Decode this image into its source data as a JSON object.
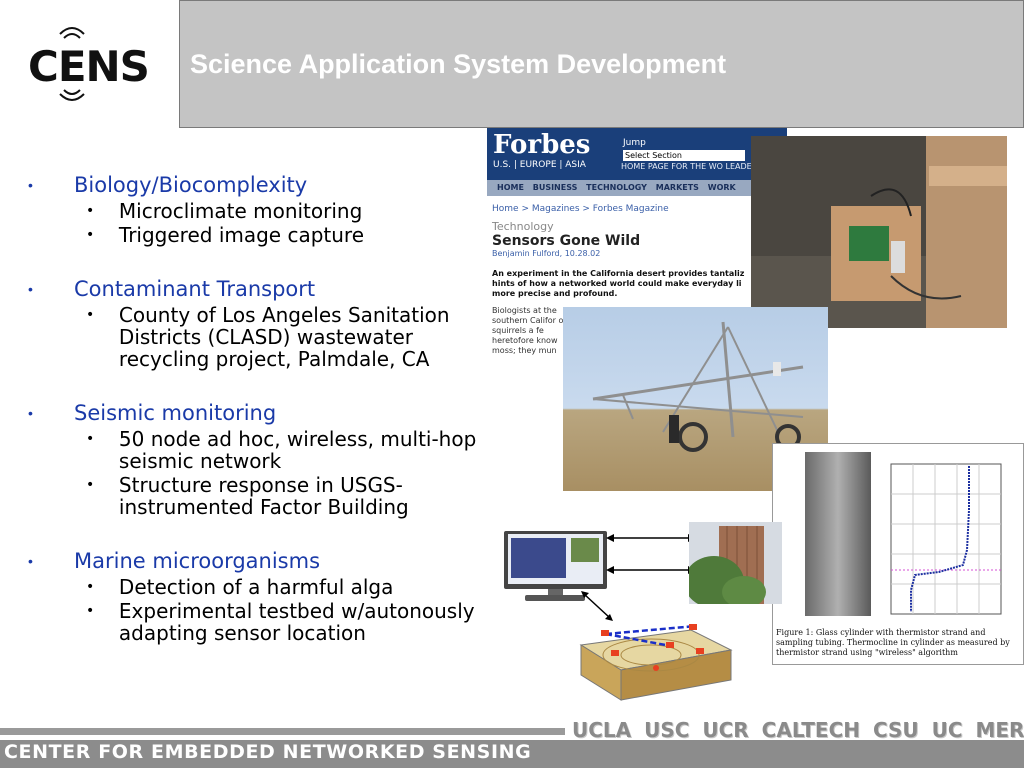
{
  "logo": {
    "text": "CENS"
  },
  "title": "Science Application System Development",
  "bullets": [
    {
      "label": "Biology/Biocomplexity",
      "subs": [
        "Microclimate monitoring",
        "Triggered image capture"
      ]
    },
    {
      "label": "Contaminant Transport",
      "subs": [
        "County of Los Angeles Sanitation Districts (CLASD) wastewater recycling project, Palmdale, CA"
      ]
    },
    {
      "label": "Seismic monitoring",
      "subs": [
        "50 node ad hoc, wireless, multi-hop seismic network",
        "Structure response in USGS-instrumented Factor Building"
      ]
    },
    {
      "label": "Marine microorganisms",
      "subs": [
        "Detection of a  harmful alga",
        "Experimental testbed w/autonously adapting sensor location"
      ]
    }
  ],
  "bullet_glyph": "•",
  "forbes": {
    "logo": "Forbes",
    "regions": "U.S. | EUROPE | ASIA",
    "jump": "Jump",
    "select": "Select Section",
    "home_link": "HOME PAGE FOR THE WO LEADERS",
    "nav": [
      "HOME",
      "BUSINESS",
      "TECHNOLOGY",
      "MARKETS",
      "WORK"
    ],
    "breadcrumb": "Home > Magazines > Forbes Magazine",
    "section": "Technology",
    "headline": "Sensors Gone Wild",
    "author": "Benjamin Fulford, 10.28.02",
    "lede": "An experiment in the California desert provides tantaliz hints of how a networked world could make everyday li more precise and profound.",
    "body": "Biologists at the southern Califor of squirrels a fe heretofore know moss; they mun been in the right"
  },
  "figure": {
    "caption": "Figure 1: Glass cylinder with thermistor strand and sampling tubing. Thermocline in cylinder as measured by thermistor strand using \"wireless\" algorithm"
  },
  "footer": {
    "org": "CENTER FOR EMBEDDED NETWORKED SENSING",
    "universities": "UCLA USC UCR CALTECH CSU UC MERCED"
  },
  "colors": {
    "bullet_blue": "#1a3aa8",
    "title_bg": "#c4c4c4",
    "footer_gray": "#8c8c8c"
  }
}
